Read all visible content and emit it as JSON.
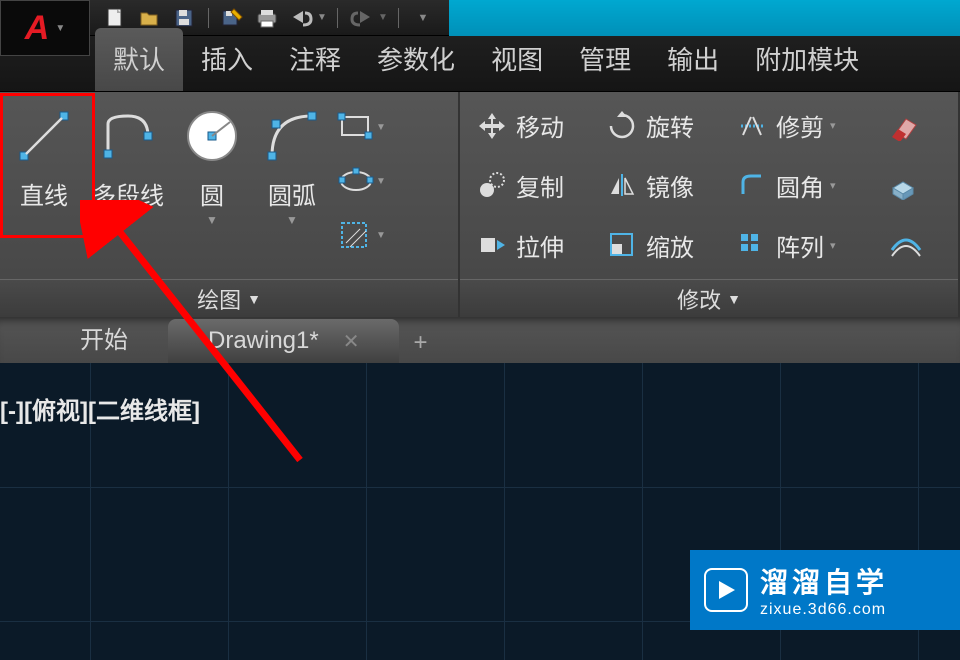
{
  "app": {
    "name": "AutoCAD"
  },
  "qat": {
    "items": [
      "new",
      "open",
      "save",
      "saveas",
      "print",
      "undo",
      "redo",
      "more"
    ]
  },
  "ribbon": {
    "tabs": [
      "默认",
      "插入",
      "注释",
      "参数化",
      "视图",
      "管理",
      "输出",
      "附加模块"
    ],
    "active_tab_index": 0,
    "draw_panel": {
      "title": "绘图",
      "tools": {
        "line": "直线",
        "polyline": "多段线",
        "circle": "圆",
        "arc": "圆弧"
      }
    },
    "modify_panel": {
      "title": "修改",
      "row1": {
        "move": "移动",
        "rotate": "旋转",
        "trim": "修剪"
      },
      "row2": {
        "copy": "复制",
        "mirror": "镜像",
        "fillet": "圆角"
      },
      "row3": {
        "stretch": "拉伸",
        "scale": "缩放",
        "array": "阵列"
      }
    }
  },
  "doc_tabs": {
    "start": "开始",
    "active": "Drawing1*"
  },
  "viewport": {
    "label": "[-][俯视][二维线框]"
  },
  "watermark": {
    "top": "溜溜自学",
    "bottom": "zixue.3d66.com"
  },
  "colors": {
    "accent_blue": "#00a8d0",
    "highlight_red": "#ff0000"
  }
}
